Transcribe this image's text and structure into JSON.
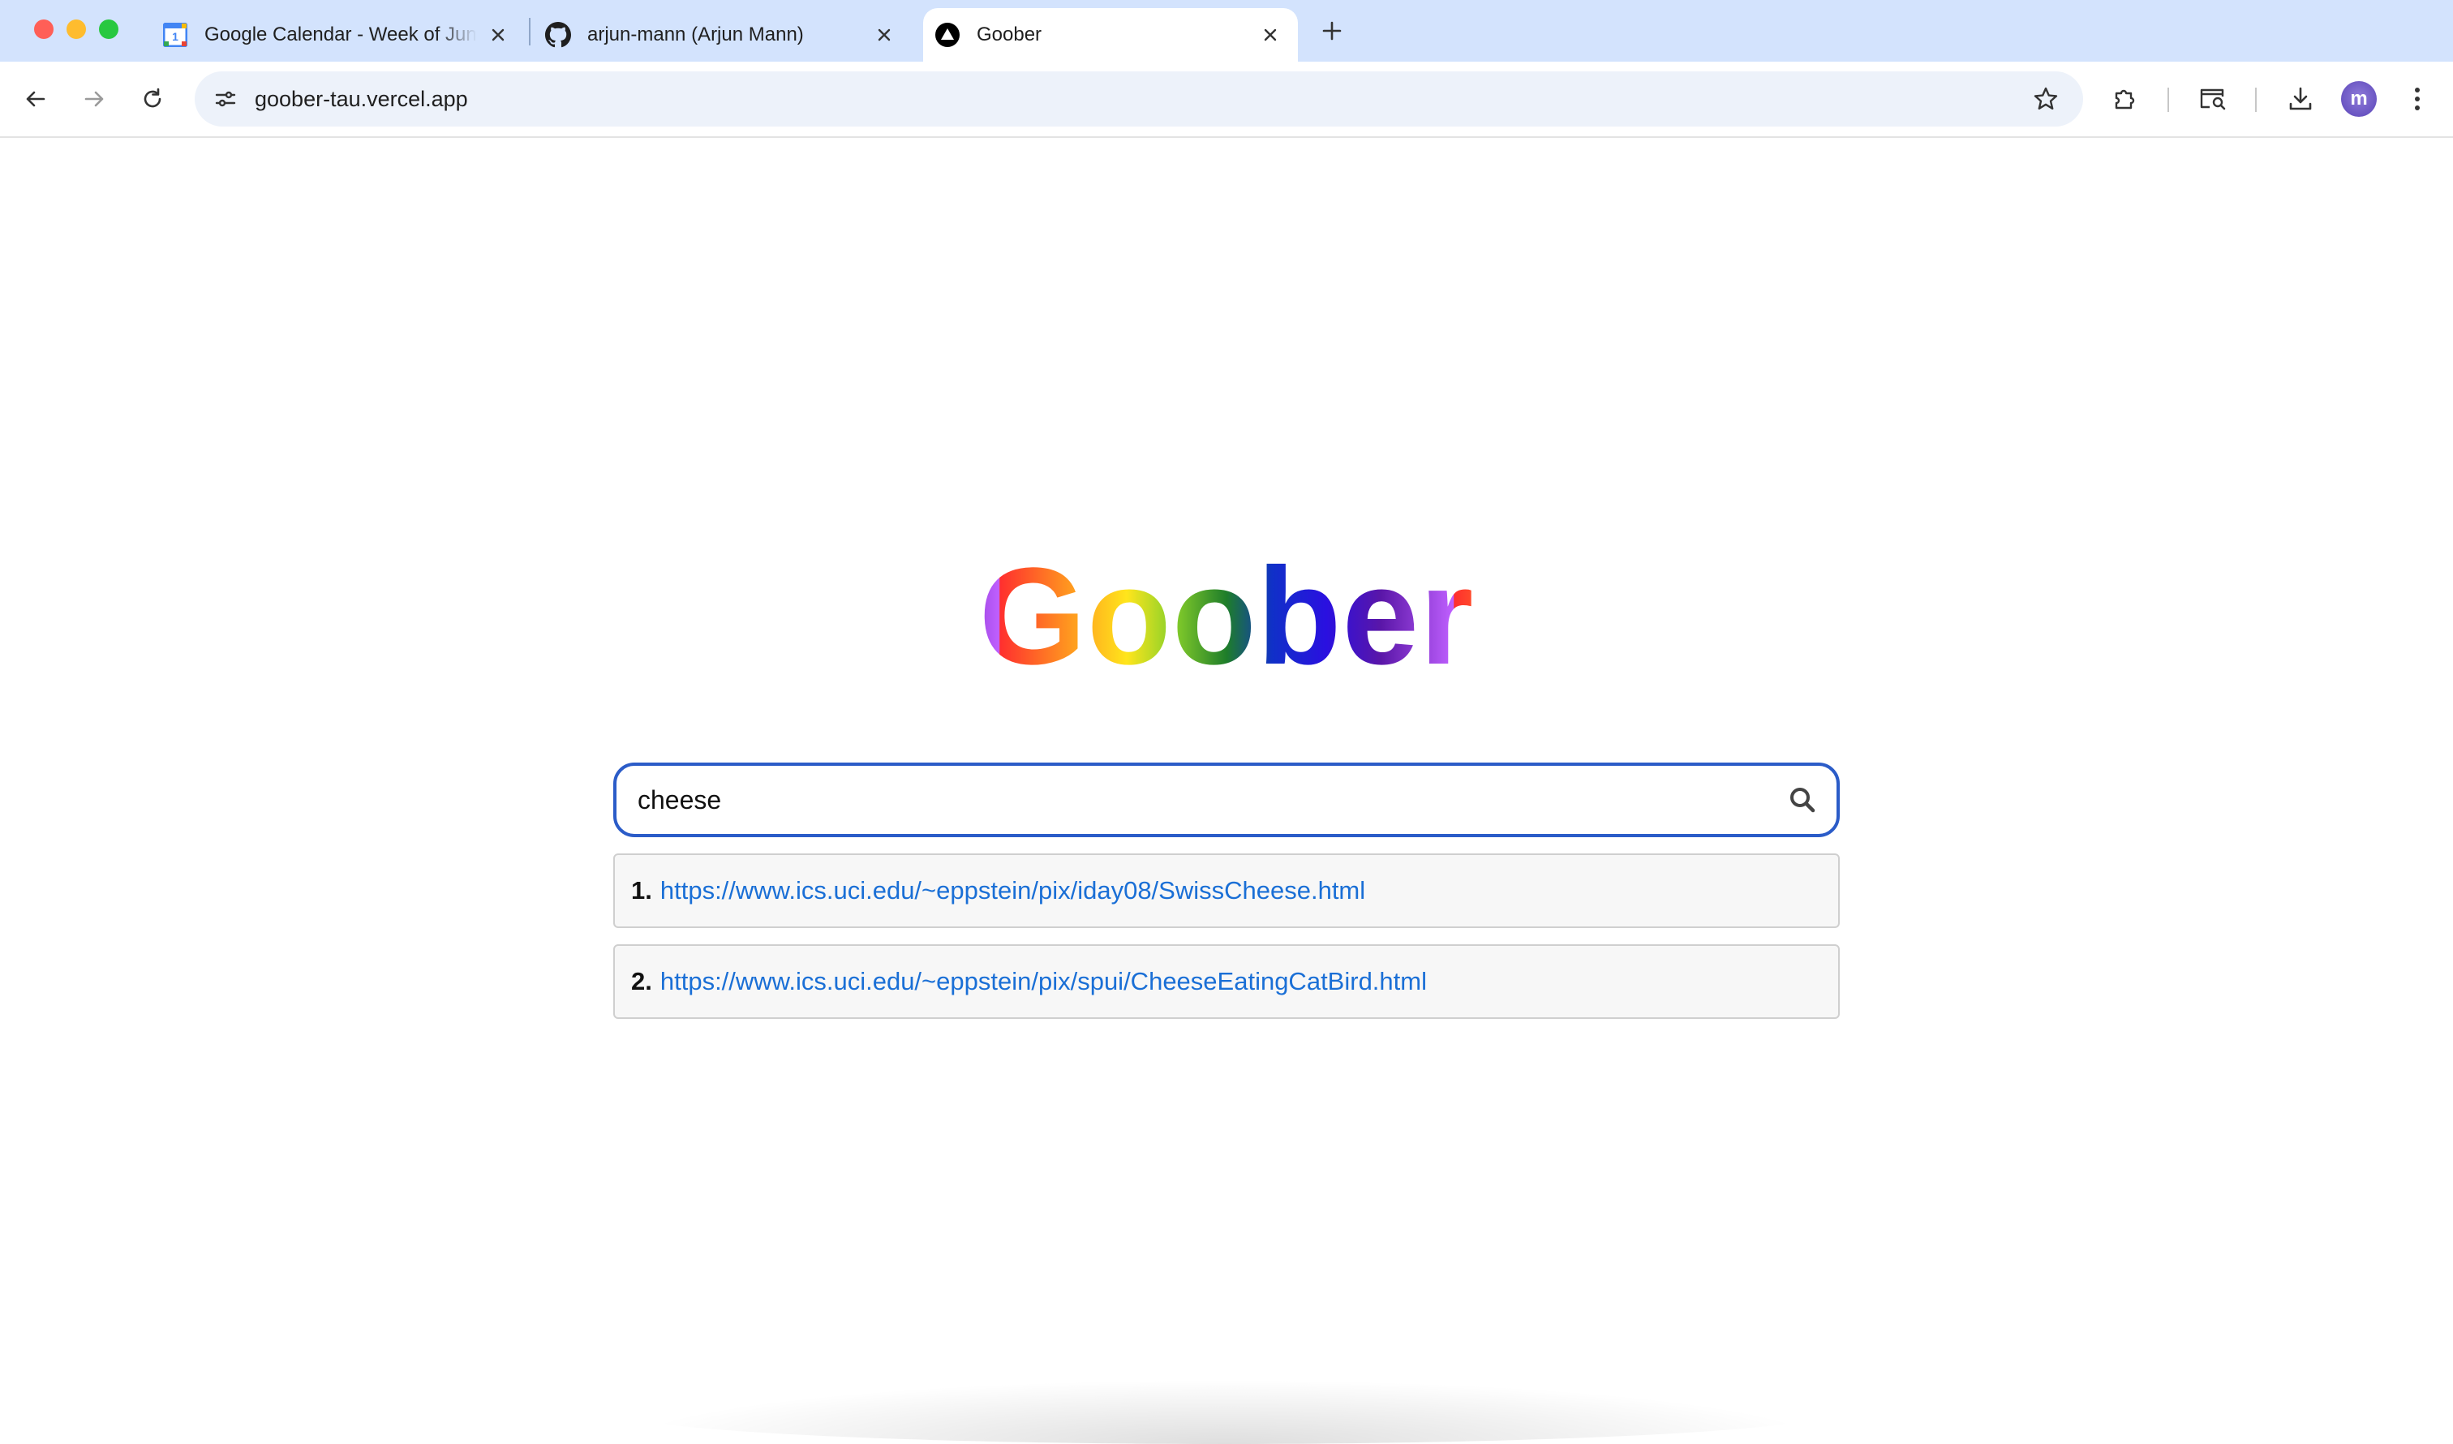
{
  "browser": {
    "tabs": [
      {
        "title": "Google Calendar - Week of June",
        "favicon": "google-calendar-icon",
        "active": false
      },
      {
        "title": "arjun-mann (Arjun Mann)",
        "favicon": "github-icon",
        "active": false
      },
      {
        "title": "Goober",
        "favicon": "vercel-icon",
        "active": true
      }
    ],
    "calendar_favicon_day": "1",
    "url": "goober-tau.vercel.app",
    "avatar_initial": "m"
  },
  "page": {
    "logo_text": "Goober",
    "search": {
      "query": "cheese",
      "button_icon": "search-icon"
    },
    "results": [
      {
        "number": "1.",
        "url": "https://www.ics.uci.edu/~eppstein/pix/iday08/SwissCheese.html"
      },
      {
        "number": "2.",
        "url": "https://www.ics.uci.edu/~eppstein/pix/spui/CheeseEatingCatBird.html"
      }
    ]
  },
  "colors": {
    "tabstrip_bg": "#d3e3fd",
    "search_border": "#2b5cc8",
    "link": "#1a6fd6"
  }
}
